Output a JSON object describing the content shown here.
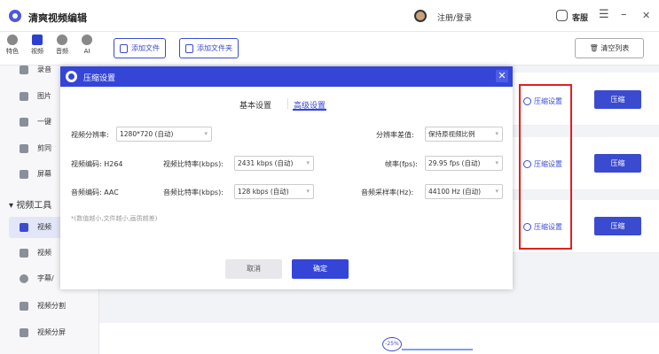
{
  "app": {
    "title": "清爽视频编辑",
    "login": "注册/登录",
    "service": "客服"
  },
  "window_controls": {
    "menu": "☰",
    "minimize": "–",
    "close": "✕"
  },
  "topnav": [
    {
      "label": "特色",
      "icon": "feature-icon"
    },
    {
      "label": "视频",
      "icon": "video-icon"
    },
    {
      "label": "音频",
      "icon": "audio-icon"
    },
    {
      "label": "AI",
      "icon": "ai-icon"
    }
  ],
  "toolbar": {
    "add_file": "添加文件",
    "add_folder": "添加文件夹",
    "clear_list": "清空列表"
  },
  "sidebar": {
    "items": [
      {
        "label": "录音",
        "icon": "record-icon"
      },
      {
        "label": "图片",
        "icon": "image-icon"
      },
      {
        "label": "一键",
        "icon": "onekey-icon"
      },
      {
        "label": "剪同",
        "icon": "clip-icon"
      },
      {
        "label": "屏幕",
        "icon": "screen-icon"
      }
    ],
    "group": "视频工具",
    "tools": [
      {
        "label": "视频",
        "icon": "video-compress-icon"
      },
      {
        "label": "视频",
        "icon": "video-tool-icon"
      },
      {
        "label": "字幕/",
        "icon": "subtitle-icon"
      },
      {
        "label": "视频分割",
        "icon": "split-icon"
      },
      {
        "label": "视频分屏",
        "icon": "splitscreen-icon"
      }
    ]
  },
  "rows": [
    {
      "settings": "压缩设置",
      "action": "压缩"
    },
    {
      "settings": "压缩设置",
      "action": "压缩"
    },
    {
      "settings": "压缩设置",
      "action": "压缩"
    }
  ],
  "progress": {
    "percent": "-25%"
  },
  "dialog": {
    "title": "压缩设置",
    "tabs": {
      "basic": "基本设置",
      "advanced": "高级设置"
    },
    "resolution_label": "视频分辨率:",
    "resolution_value": "1280*720 (自动)",
    "diff_label": "分辨率差值:",
    "diff_value": "保持原视频比例",
    "vcodec": "视频编码: H264",
    "vbitrate_label": "视频比特率(kbps):",
    "vbitrate_value": "2431 kbps (自动)",
    "fps_label": "帧率(fps):",
    "fps_value": "29.95 fps (自动)",
    "acodec": "音频编码: AAC",
    "abitrate_label": "音频比特率(kbps):",
    "abitrate_value": "128 kbps (自动)",
    "asample_label": "音频采样率(Hz):",
    "asample_value": "44100 Hz (自动)",
    "note": "*(数值越小,文件越小,画质越差)",
    "cancel": "取消",
    "ok": "确定",
    "close": "✕"
  },
  "colors": {
    "accent": "#3445d8",
    "highlight": "#e02020"
  }
}
